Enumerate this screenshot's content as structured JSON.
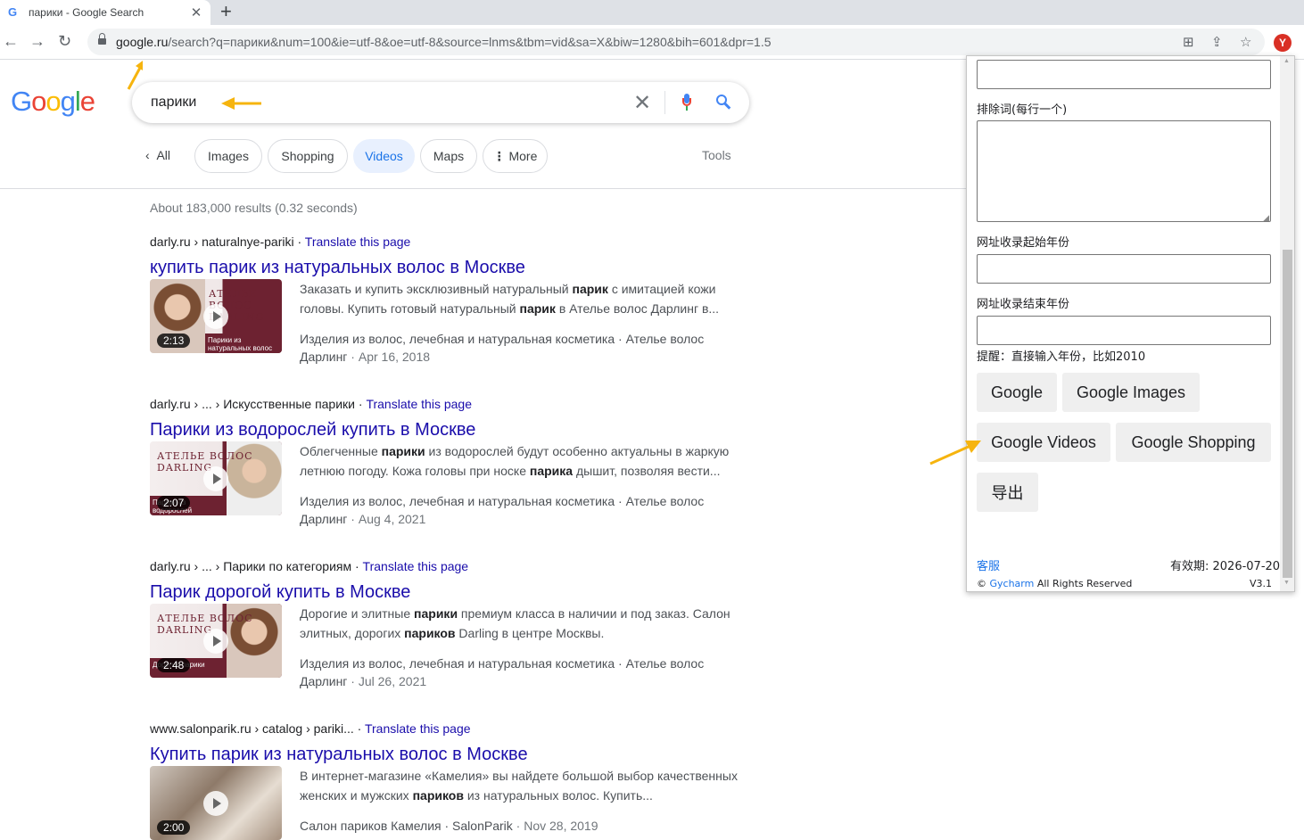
{
  "browser": {
    "tab_title": "парики - Google Search",
    "new_tab": "+",
    "url_host": "google.ru",
    "url_rest": "/search?q=парики&num=100&ie=utf-8&oe=utf-8&source=lnms&tbm=vid&sa=X&biw=1280&bih=601&dpr=1.5",
    "extension_badge": "Y"
  },
  "google": {
    "logo": "Google",
    "query": "парики",
    "chips": {
      "all": "All",
      "images": "Images",
      "shopping": "Shopping",
      "videos": "Videos",
      "maps": "Maps",
      "more": "More"
    },
    "tools": "Tools",
    "stats": "About 183,000 results (0.32 seconds)"
  },
  "results": [
    {
      "cite": "darly.ru › naturalnye-pariki",
      "translate": "Translate this page",
      "title": "купить парик из натуральных волос в Москве",
      "duration": "2:13",
      "brand": "АТЕЛЬЕ ВОЛОС DARLING",
      "band": "Парики из натуральных волос",
      "snippet_a": "Заказать и купить эксклюзивный натуральный ",
      "snippet_b1": "парик",
      "snippet_c": " с имитацией кожи головы. Купить готовый натуральный ",
      "snippet_b2": "парик",
      "snippet_d": " в Ателье волос Дарлинг в...",
      "source": "Изделия из волос, лечебная и натуральная косметика · Ателье волос Дарлинг",
      "date": "Apr 16, 2018"
    },
    {
      "cite": "darly.ru › ... › Искусственные парики",
      "translate": "Translate this page",
      "title": "Парики из водорослей купить в Москве",
      "duration": "2:07",
      "brand": "АТЕЛЬЕ ВОЛОС DARLING",
      "band": "Парики из водорослей",
      "snippet_a": "Облегченные ",
      "snippet_b1": "парики",
      "snippet_c": " из водорослей будут особенно актуальны в жаркую летнюю погоду. Кожа головы при носке ",
      "snippet_b2": "парика",
      "snippet_d": " дышит, позволяя вести...",
      "source": "Изделия из волос, лечебная и натуральная косметика · Ателье волос Дарлинг",
      "date": "Aug 4, 2021"
    },
    {
      "cite": "darly.ru › ... › Парики по категориям",
      "translate": "Translate this page",
      "title": "Парик дорогой купить в Москве",
      "duration": "2:48",
      "brand": "АТЕЛЬЕ ВОЛОС DARLING",
      "band": "Дорогие парики",
      "snippet_a": "Дорогие и элитные ",
      "snippet_b1": "парики",
      "snippet_c": " премиум класса в наличии и под заказ. Салон элитных, дорогих ",
      "snippet_b2": "париков",
      "snippet_d": " Darling в центре Москвы.",
      "source": "Изделия из волос, лечебная и натуральная косметика · Ателье волос Дарлинг",
      "date": "Jul 26, 2021"
    },
    {
      "cite": "www.salonparik.ru › catalog › pariki...",
      "translate": "Translate this page",
      "title": "Купить парик из натуральных волос в Москве",
      "duration": "2:00",
      "brand": "",
      "band": "",
      "snippet_a": "В интернет-магазине «Камелия» вы найдете большой выбор качественных женских и мужских ",
      "snippet_b1": "париков",
      "snippet_c": " из натуральных волос. Купить...",
      "snippet_b2": "",
      "snippet_d": "",
      "source": "Салон париков Камелия · SalonParik",
      "date": "Nov 28, 2019"
    }
  ],
  "popup": {
    "exclude_label": "排除词(每行一个)",
    "start_year_label": "网址收录起始年份",
    "end_year_label": "网址收录结束年份",
    "hint": "提醒：直接输入年份，比如2010",
    "btn_google": "Google",
    "btn_google_images": "Google Images",
    "btn_google_videos": "Google Videos",
    "btn_google_shopping": "Google Shopping",
    "btn_export": "导出",
    "support": "客服",
    "expiry": "有效期: 2026-07-20",
    "copyright_symbol": "©",
    "brand_link": "Gycharm",
    "rights": "All Rights Reserved",
    "version": "V3.1"
  },
  "colors": {
    "link": "#1a0dab",
    "accent": "#1a73e8",
    "annotation": "#f6b40e"
  }
}
